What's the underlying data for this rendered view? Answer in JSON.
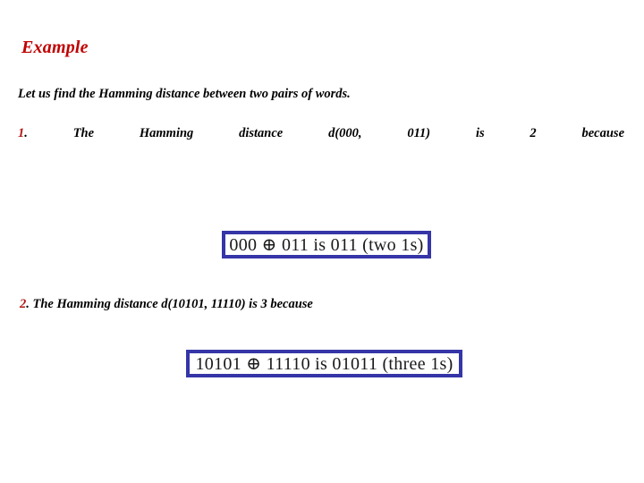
{
  "slide": {
    "title": "Example",
    "intro": "Let us find the Hamming distance between two pairs of words.",
    "colors": {
      "title_red": "#C00000",
      "marker_red": "#B01818",
      "box_blue": "#3535A8",
      "text_black": "#000000",
      "background": "#FFFFFF"
    }
  },
  "item_one": {
    "marker_number": "1",
    "marker_dot": ".",
    "words": [
      "The",
      "Hamming",
      "distance",
      "d(000,",
      "011)",
      "is",
      "2",
      "because"
    ]
  },
  "item_two": {
    "marker_number": "2",
    "marker_dot": ".",
    "text": "The Hamming distance d(10101, 11110) is 3 because"
  },
  "formula_one": {
    "text": "000 ⊕ 011 is 011 (two 1s)"
  },
  "formula_two": {
    "text": "10101 ⊕ 11110 is 01011 (three 1s)"
  }
}
